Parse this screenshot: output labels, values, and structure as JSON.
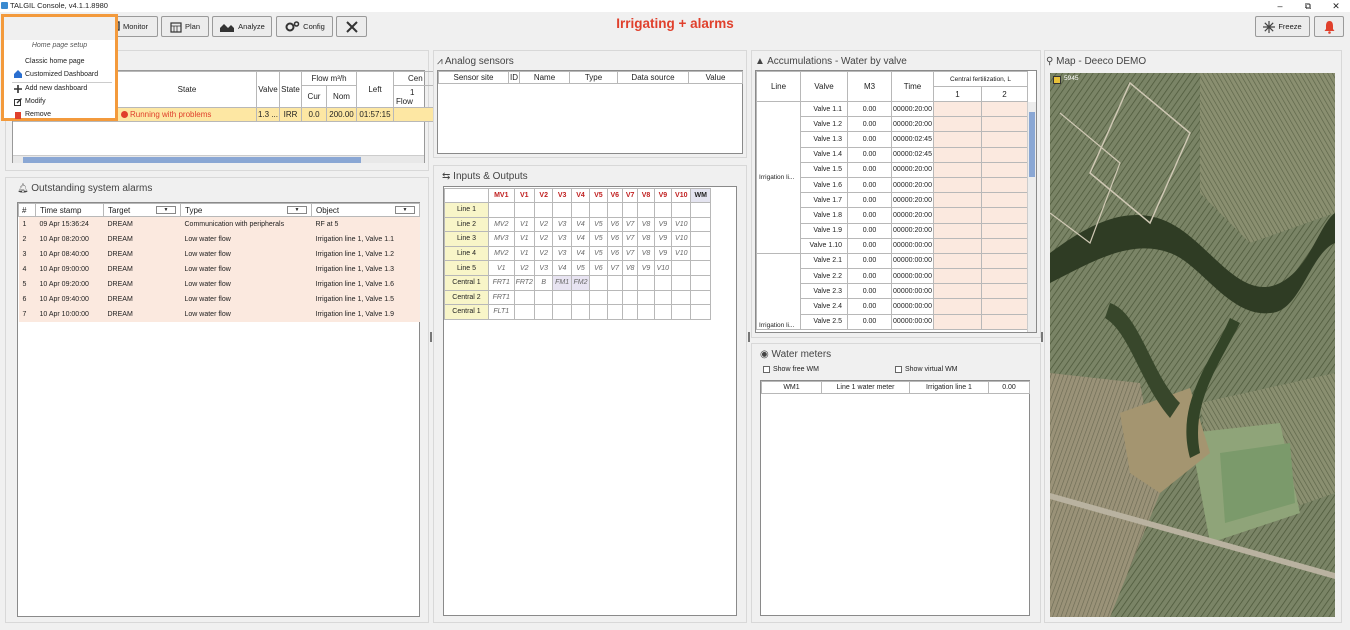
{
  "window": {
    "title": "TALGIL Console, v4.1.1.8980",
    "minimize": "–",
    "maximize": "⧉",
    "close": "✕"
  },
  "toolbar": {
    "monitor": "Monitor",
    "plan": "Plan",
    "analyze": "Analyze",
    "config": "Config",
    "freeze": "Freeze"
  },
  "main_title": "Irrigating + alarms",
  "menu": {
    "header": "Home page setup",
    "items": [
      "Classic home page",
      "Customized Dashboard",
      "Add new dashboard",
      "Modify",
      "Remove"
    ]
  },
  "lines_panel": {
    "headers": {
      "state": "State",
      "valve": "Valve",
      "state2": "State",
      "flow": "Flow m³/h",
      "cur": "Cur",
      "nom": "Nom",
      "left": "Left",
      "cen": "Cen",
      "cen1": "1",
      "cflow": "Flow"
    },
    "row": {
      "state": "Running with problems",
      "valve": "1.3 ...",
      "state2": "IRR",
      "cur": "0.0",
      "nom": "200.00",
      "left": "01:57:15"
    }
  },
  "alarms": {
    "title": "Outstanding system alarms",
    "headers": [
      "#",
      "Time stamp",
      "Target",
      "Type",
      "Object"
    ],
    "rows": [
      [
        "1",
        "09 Apr 15:36:24",
        "DREAM",
        "Communication with peripherals",
        "RF at 5"
      ],
      [
        "2",
        "10 Apr 08:20:00",
        "DREAM",
        "Low water flow",
        "Irrigation line 1, Valve 1.1"
      ],
      [
        "3",
        "10 Apr 08:40:00",
        "DREAM",
        "Low water flow",
        "Irrigation line 1, Valve 1.2"
      ],
      [
        "4",
        "10 Apr 09:00:00",
        "DREAM",
        "Low water flow",
        "Irrigation line 1, Valve 1.3"
      ],
      [
        "5",
        "10 Apr 09:20:00",
        "DREAM",
        "Low water flow",
        "Irrigation line 1, Valve 1.6"
      ],
      [
        "6",
        "10 Apr 09:40:00",
        "DREAM",
        "Low water flow",
        "Irrigation line 1, Valve 1.5"
      ],
      [
        "7",
        "10 Apr 10:00:00",
        "DREAM",
        "Low water flow",
        "Irrigation line 1, Valve 1.9"
      ]
    ]
  },
  "analog": {
    "title": "Analog sensors",
    "headers": [
      "Sensor site",
      "ID",
      "Name",
      "Type",
      "Data source",
      "Value"
    ]
  },
  "io": {
    "title": "Inputs & Outputs",
    "headers": [
      "MV1",
      "V1",
      "V2",
      "V3",
      "V4",
      "V5",
      "V6",
      "V7",
      "V8",
      "V9",
      "V10",
      "WM"
    ],
    "rows": [
      {
        "label": "Line 1",
        "cells": [
          "",
          "",
          "",
          "",
          "",
          "",
          "",
          "",
          "",
          "",
          "",
          ""
        ]
      },
      {
        "label": "Line 2",
        "cells": [
          "MV2",
          "V1",
          "V2",
          "V3",
          "V4",
          "V5",
          "V6",
          "V7",
          "V8",
          "V9",
          "V10",
          ""
        ]
      },
      {
        "label": "Line 3",
        "cells": [
          "MV3",
          "V1",
          "V2",
          "V3",
          "V4",
          "V5",
          "V6",
          "V7",
          "V8",
          "V9",
          "V10",
          ""
        ]
      },
      {
        "label": "Line 4",
        "cells": [
          "MV2",
          "V1",
          "V2",
          "V3",
          "V4",
          "V5",
          "V6",
          "V7",
          "V8",
          "V9",
          "V10",
          ""
        ]
      },
      {
        "label": "Line 5",
        "cells": [
          "V1",
          "V2",
          "V3",
          "V4",
          "V5",
          "V6",
          "V7",
          "V8",
          "V9",
          "V10",
          "",
          ""
        ]
      },
      {
        "label": "Central 1",
        "cells": [
          "FRT1",
          "FRT2",
          "B",
          "FM1",
          "FM2",
          "",
          "",
          "",
          "",
          "",
          "",
          ""
        ]
      },
      {
        "label": "Central 2",
        "cells": [
          "FRT1",
          "",
          "",
          "",
          "",
          "",
          "",
          "",
          "",
          "",
          "",
          ""
        ]
      },
      {
        "label": "Central 1",
        "cells": [
          "FLT1",
          "",
          "",
          "",
          "",
          "",
          "",
          "",
          "",
          "",
          "",
          ""
        ]
      }
    ]
  },
  "accum": {
    "title": "Accumulations - Water by valve",
    "headers": {
      "line": "Line",
      "valve": "Valve",
      "m3": "M3",
      "time": "Time",
      "cf": "Central fertilization, L",
      "cf1": "1",
      "cf2": "2"
    },
    "line_labels": [
      "Irrigation li...",
      "Irrigation li..."
    ],
    "rows": [
      [
        "Valve 1.1",
        "0.00",
        "00000:20:00"
      ],
      [
        "Valve 1.2",
        "0.00",
        "00000:20:00"
      ],
      [
        "Valve 1.3",
        "0.00",
        "00000:02:45"
      ],
      [
        "Valve 1.4",
        "0.00",
        "00000:02:45"
      ],
      [
        "Valve 1.5",
        "0.00",
        "00000:20:00"
      ],
      [
        "Valve 1.6",
        "0.00",
        "00000:20:00"
      ],
      [
        "Valve 1.7",
        "0.00",
        "00000:20:00"
      ],
      [
        "Valve 1.8",
        "0.00",
        "00000:20:00"
      ],
      [
        "Valve 1.9",
        "0.00",
        "00000:20:00"
      ],
      [
        "Valve 1.10",
        "0.00",
        "00000:00:00"
      ],
      [
        "Valve 2.1",
        "0.00",
        "00000:00:00"
      ],
      [
        "Valve 2.2",
        "0.00",
        "00000:00:00"
      ],
      [
        "Valve 2.3",
        "0.00",
        "00000:00:00"
      ],
      [
        "Valve 2.4",
        "0.00",
        "00000:00:00"
      ],
      [
        "Valve 2.5",
        "0.00",
        "00000:00:00"
      ]
    ]
  },
  "water_meters": {
    "title": "Water meters",
    "show_free": "Show free WM",
    "show_virtual": "Show virtual WM",
    "row": [
      "WM1",
      "Line 1 water meter",
      "Irrigation line 1",
      "0.00"
    ]
  },
  "map": {
    "title": "Map - Deeco DEMO",
    "marker_label": "5945"
  },
  "colors": {
    "accent": "#e0402c",
    "menu_border": "#f39a3c",
    "alarm_row": "#fbe9df",
    "selected_row": "#fde7a3"
  }
}
